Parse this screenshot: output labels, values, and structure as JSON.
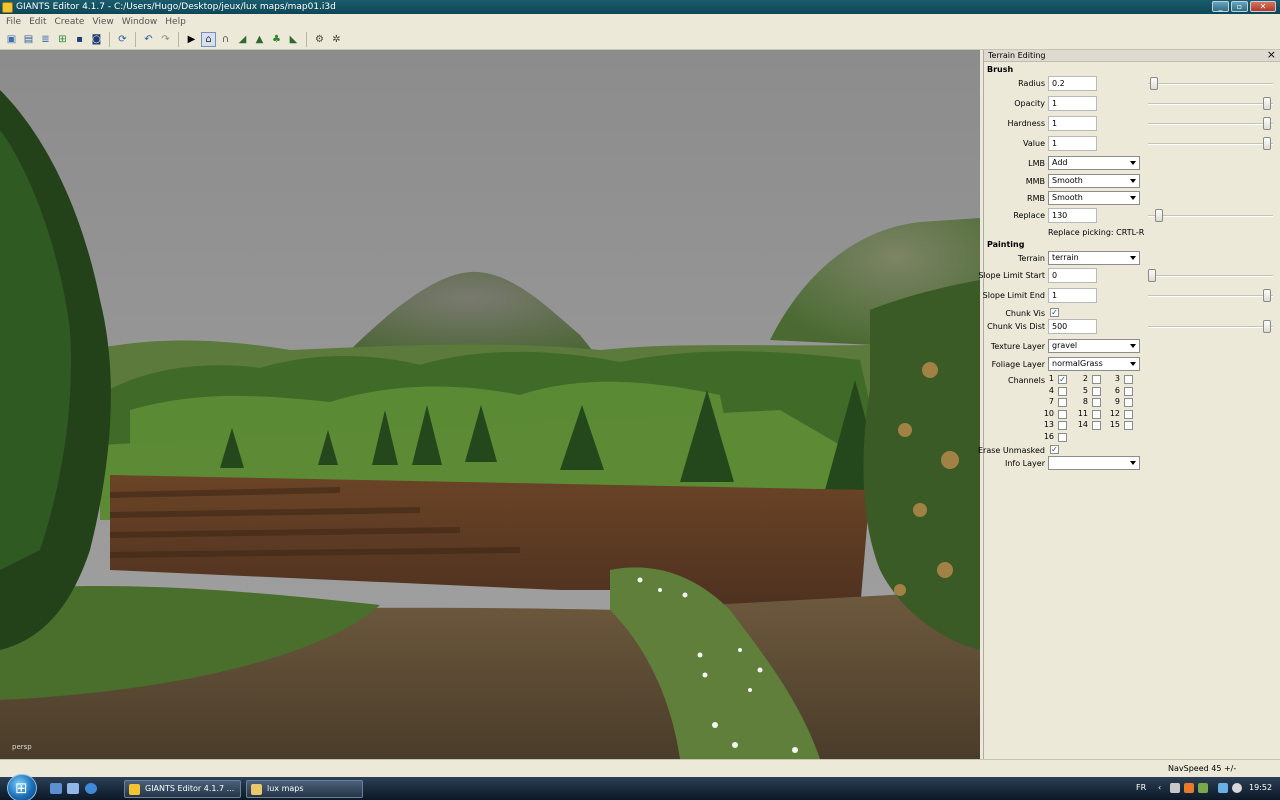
{
  "window": {
    "title": "GIANTS Editor 4.1.7 - C:/Users/Hugo/Desktop/jeux/lux maps/map01.i3d",
    "buttons": [
      "minimize-icon",
      "maximize-icon",
      "close-icon"
    ]
  },
  "menu": [
    "File",
    "Edit",
    "Create",
    "View",
    "Window",
    "Help"
  ],
  "toolbar": {
    "icons": [
      "new-icon",
      "open-icon",
      "list-icon",
      "import-icon",
      "save-icon",
      "save-all-icon",
      "refresh-icon",
      "undo-icon",
      "redo-icon",
      "play-icon",
      "select-tool-icon",
      "move-tool-icon",
      "terrain-sculpt-icon",
      "terrain-paint-icon",
      "foliage-paint-icon",
      "terrain-smooth-icon",
      "settings-icon",
      "settings2-icon"
    ],
    "active": "select-tool-icon"
  },
  "viewport": {
    "camera_label": "persp"
  },
  "panel": {
    "title": "Terrain Editing",
    "brush_header": "Brush",
    "radius": {
      "label": "Radius",
      "value": "0.2",
      "slider": 0.02
    },
    "opacity": {
      "label": "Opacity",
      "value": "1",
      "slider": 1.0
    },
    "hardness": {
      "label": "Hardness",
      "value": "1",
      "slider": 1.0
    },
    "value": {
      "label": "Value",
      "value": "1",
      "slider": 1.0
    },
    "lmb": {
      "label": "LMB",
      "value": "Add"
    },
    "mmb": {
      "label": "MMB",
      "value": "Smooth"
    },
    "rmb": {
      "label": "RMB",
      "value": "Smooth"
    },
    "replace": {
      "label": "Replace",
      "value": "130",
      "slider": 0.06
    },
    "replace_note": "Replace picking: CRTL-R",
    "painting_header": "Painting",
    "terrain": {
      "label": "Terrain",
      "value": "terrain"
    },
    "slope_start": {
      "label": "Slope Limit Start",
      "value": "0",
      "slider": 0.0
    },
    "slope_end": {
      "label": "Slope Limit End",
      "value": "1",
      "slider": 1.0
    },
    "chunk_vis": {
      "label": "Chunk Vis",
      "checked": true
    },
    "chunk_vis_dist": {
      "label": "Chunk Vis Dist",
      "value": "500",
      "slider": 1.0
    },
    "texture_layer": {
      "label": "Texture Layer",
      "value": "gravel"
    },
    "foliage_layer": {
      "label": "Foliage Layer",
      "value": "normalGrass"
    },
    "channels_label": "Channels",
    "channels": [
      {
        "n": "1",
        "checked": true
      },
      {
        "n": "2",
        "checked": false
      },
      {
        "n": "3",
        "checked": false
      },
      {
        "n": "4",
        "checked": false
      },
      {
        "n": "5",
        "checked": false
      },
      {
        "n": "6",
        "checked": false
      },
      {
        "n": "7",
        "checked": false
      },
      {
        "n": "8",
        "checked": false
      },
      {
        "n": "9",
        "checked": false
      },
      {
        "n": "10",
        "checked": false
      },
      {
        "n": "11",
        "checked": false
      },
      {
        "n": "12",
        "checked": false
      },
      {
        "n": "13",
        "checked": false
      },
      {
        "n": "14",
        "checked": false
      },
      {
        "n": "15",
        "checked": false
      },
      {
        "n": "16",
        "checked": false
      }
    ],
    "erase_unmasked": {
      "label": "Erase Unmasked",
      "checked": true
    },
    "info_layer": {
      "label": "Info Layer",
      "value": ""
    }
  },
  "status": {
    "navspeed": "NavSpeed 45 +/-"
  },
  "taskbar": {
    "tasks": [
      {
        "label": "GIANTS Editor 4.1.7 ...",
        "color": "#f3c431"
      },
      {
        "label": "lux maps",
        "color": "#e8c86a"
      }
    ],
    "language": "FR",
    "clock": "19:52"
  },
  "colors": {
    "titlebar": "#1a5c6e",
    "panel_bg": "#ece9d8",
    "sky": "#8e8e8e",
    "field": "#5a3a22",
    "grass": "#4f7a2e"
  }
}
